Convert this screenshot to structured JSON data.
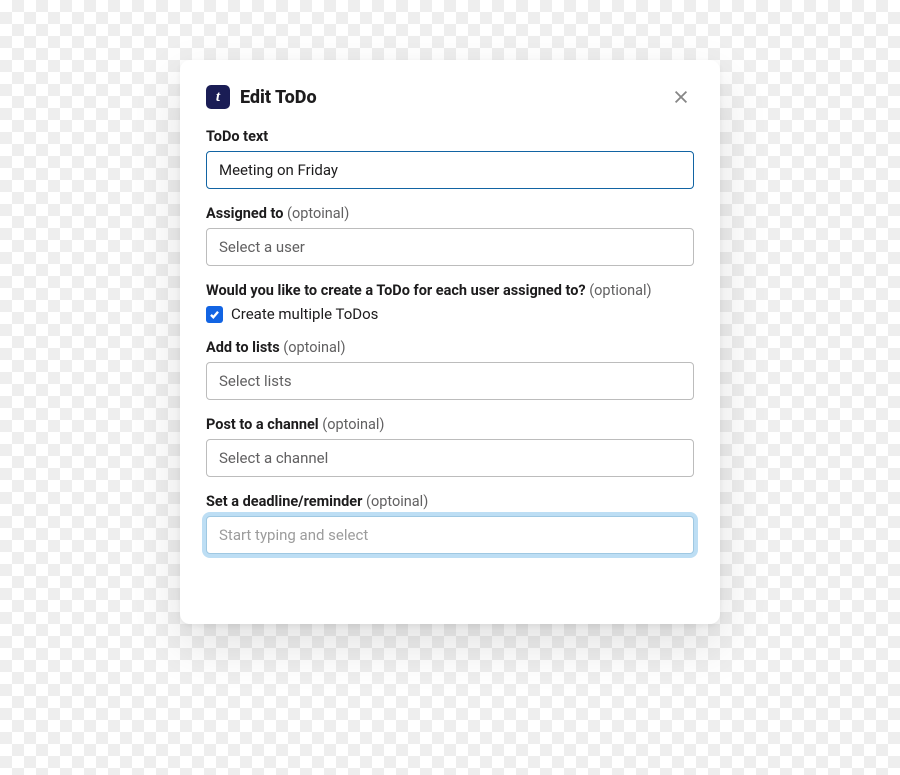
{
  "header": {
    "app_letter": "t",
    "title": "Edit ToDo"
  },
  "fields": {
    "todo_text": {
      "label": "ToDo text",
      "value": "Meeting on Friday"
    },
    "assigned_to": {
      "label": "Assigned to",
      "opt": "(optoinal)",
      "placeholder": "Select a user"
    },
    "multi_prompt": {
      "label": "Would you like to create a ToDo for each user assigned to?",
      "opt": "(optional)",
      "checkbox_label": "Create multiple ToDos",
      "checked": true
    },
    "add_to_lists": {
      "label": "Add to lists",
      "opt": "(optoinal)",
      "placeholder": "Select lists"
    },
    "post_channel": {
      "label": "Post to a channel",
      "opt": "(optoinal)",
      "placeholder": "Select a channel"
    },
    "deadline": {
      "label": "Set a deadline/reminder",
      "opt": "(optoinal)",
      "placeholder": "Start typing and select"
    }
  }
}
